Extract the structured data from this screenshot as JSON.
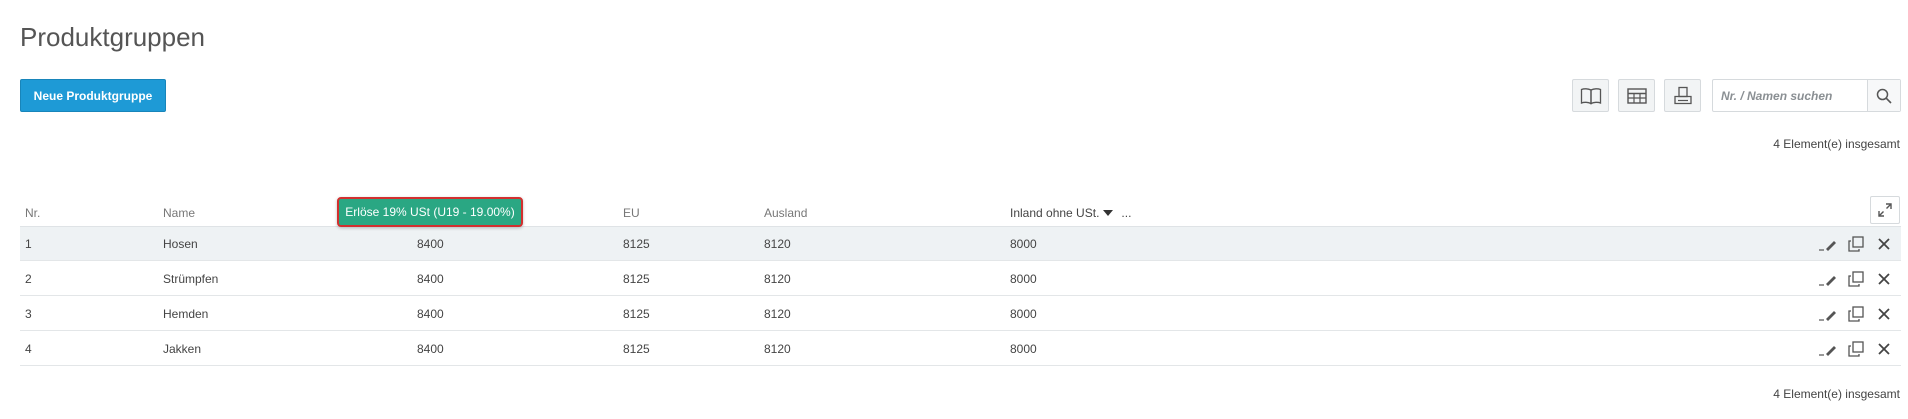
{
  "page": {
    "title": "Produktgruppen"
  },
  "toolbar": {
    "new_label": "Neue Produktgruppe",
    "search_placeholder": "Nr. / Namen suchen"
  },
  "count_text": "4 Element(e) insgesamt",
  "table": {
    "headers": {
      "nr": "Nr.",
      "name": "Name",
      "eu": "EU",
      "ausland": "Ausland",
      "inland": "Inland ohne USt.",
      "more": "..."
    },
    "tooltip": "Erlöse 19% USt (U19 - 19.00%)",
    "rows": [
      {
        "nr": "1",
        "name": "Hosen",
        "erloese": "8400",
        "eu": "8125",
        "ausland": "8120",
        "inland": "8000"
      },
      {
        "nr": "2",
        "name": "Strümpfen",
        "erloese": "8400",
        "eu": "8125",
        "ausland": "8120",
        "inland": "8000"
      },
      {
        "nr": "3",
        "name": "Hemden",
        "erloese": "8400",
        "eu": "8125",
        "ausland": "8120",
        "inland": "8000"
      },
      {
        "nr": "4",
        "name": "Jakken",
        "erloese": "8400",
        "eu": "8125",
        "ausland": "8120",
        "inland": "8000"
      }
    ]
  },
  "icons": {
    "view_book": "book-icon",
    "view_table": "table-icon",
    "print": "print-icon",
    "search": "search-icon",
    "expand": "expand-icon",
    "edit": "edit-icon",
    "copy": "copy-icon",
    "delete": "close-icon"
  },
  "colors": {
    "primary": "#1e9ad6",
    "tooltip_bg": "#2aa783",
    "tooltip_border": "#d32f2f",
    "row_highlight": "#eef2f4"
  }
}
